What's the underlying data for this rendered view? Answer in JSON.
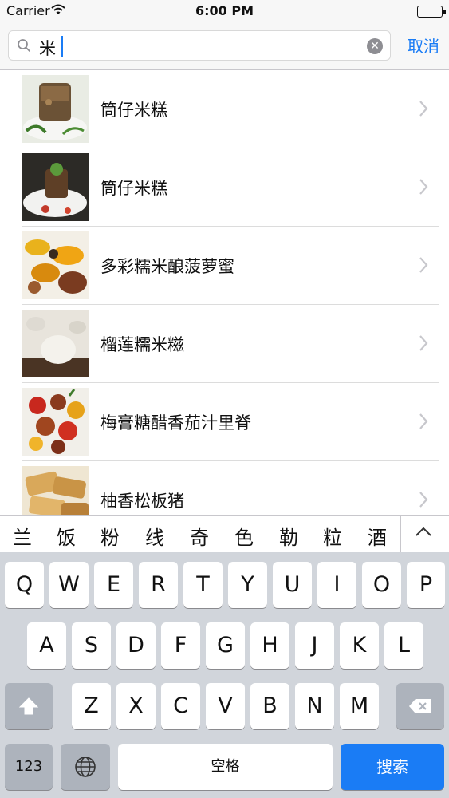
{
  "status_bar": {
    "carrier": "Carrier",
    "time": "6:00 PM"
  },
  "search": {
    "query": "米",
    "cancel_label": "取消"
  },
  "results": [
    {
      "title": "筒仔米糕"
    },
    {
      "title": "筒仔米糕"
    },
    {
      "title": "多彩糯米酿菠萝蜜"
    },
    {
      "title": "榴莲糯米糍"
    },
    {
      "title": "梅膏糖醋香茄汁里脊"
    },
    {
      "title": "柚香松板猪"
    }
  ],
  "candidates": [
    "兰",
    "饭",
    "粉",
    "线",
    "奇",
    "色",
    "勒",
    "粒",
    "酒"
  ],
  "keyboard": {
    "row1": [
      "Q",
      "W",
      "E",
      "R",
      "T",
      "Y",
      "U",
      "I",
      "O",
      "P"
    ],
    "row2": [
      "A",
      "S",
      "D",
      "F",
      "G",
      "H",
      "J",
      "K",
      "L"
    ],
    "row3": [
      "Z",
      "X",
      "C",
      "V",
      "B",
      "N",
      "M"
    ],
    "numbers_label": "123",
    "space_label": "空格",
    "return_label": "搜索"
  },
  "colors": {
    "accent": "#1a7cf5",
    "keyboard_bg": "#d1d5db",
    "function_key": "#adb3bc"
  }
}
